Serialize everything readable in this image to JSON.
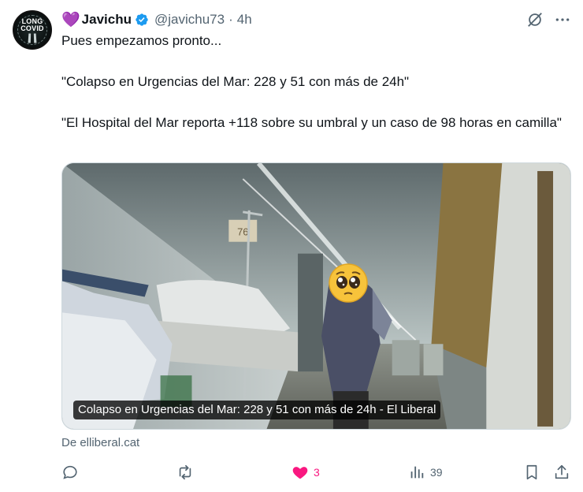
{
  "author": {
    "avatar_text": [
      "LONG",
      "COVID"
    ],
    "emoji": "💜",
    "display_name": "Javichu",
    "handle": "@javichu73",
    "separator": "·",
    "time": "4h",
    "verified_color": "#1d9bf0"
  },
  "tweet": {
    "paragraphs": [
      "Pues empezamos pronto...",
      "\"Colapso en Urgencias del Mar: 228 y 51 con más de 24h\"",
      "\"El Hospital del Mar reporta +118 sobre su umbral y un caso de 98 horas en camilla\""
    ]
  },
  "card": {
    "image_number": "76",
    "overlay_title": "Colapso en Urgencias del Mar: 228 y 51 con más de 24h - El Liberal",
    "source": "De elliberal.cat"
  },
  "actions": {
    "reply_icon": "reply-icon",
    "retweet_icon": "retweet-icon",
    "like_icon": "heart-icon",
    "like_count": "3",
    "like_color": "#f91880",
    "views_icon": "views-icon",
    "views_count": "39",
    "bookmark_icon": "bookmark-icon",
    "share_icon": "share-icon"
  },
  "colors": {
    "text_primary": "#0f1419",
    "text_secondary": "#536471",
    "border": "#cfd9de"
  }
}
